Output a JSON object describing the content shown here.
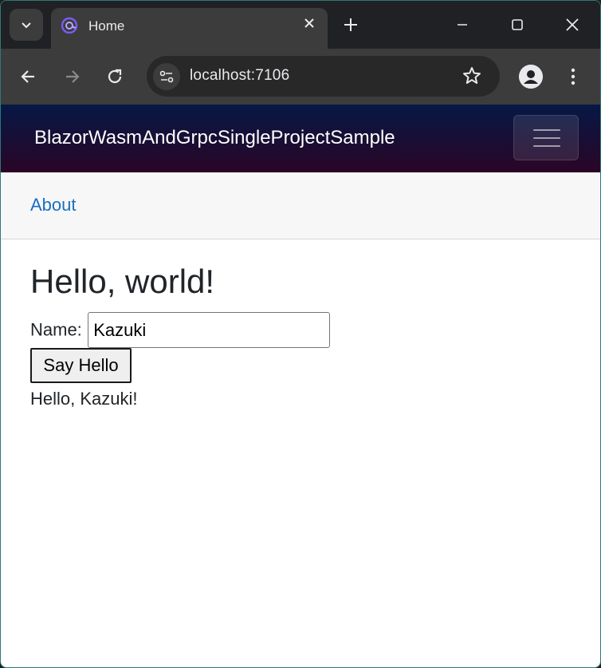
{
  "browser": {
    "tab": {
      "title": "Home"
    },
    "address_bar": {
      "url": "localhost:7106"
    }
  },
  "app": {
    "navbar": {
      "brand": "BlazorWasmAndGrpcSingleProjectSample"
    },
    "top_row": {
      "about_link": "About"
    },
    "main": {
      "heading": "Hello, world!",
      "name_label": "Name:",
      "name_input_value": "Kazuki",
      "button_label": "Say Hello",
      "result_text": "Hello, Kazuki!"
    }
  },
  "colors": {
    "navbar_gradient_top": "#061845",
    "navbar_gradient_bottom": "#2a0526",
    "link": "#1b6ec2",
    "browser_frame": "#202124",
    "browser_toolbar": "#3c3c3c"
  },
  "icons": [
    "tab-search-icon",
    "blazor-favicon-icon",
    "close-icon",
    "plus-icon",
    "minimize-icon",
    "maximize-icon",
    "window-close-icon",
    "back-arrow-icon",
    "forward-arrow-icon",
    "reload-icon",
    "site-settings-icon",
    "bookmark-star-icon",
    "profile-icon",
    "more-vert-icon",
    "hamburger-icon"
  ]
}
